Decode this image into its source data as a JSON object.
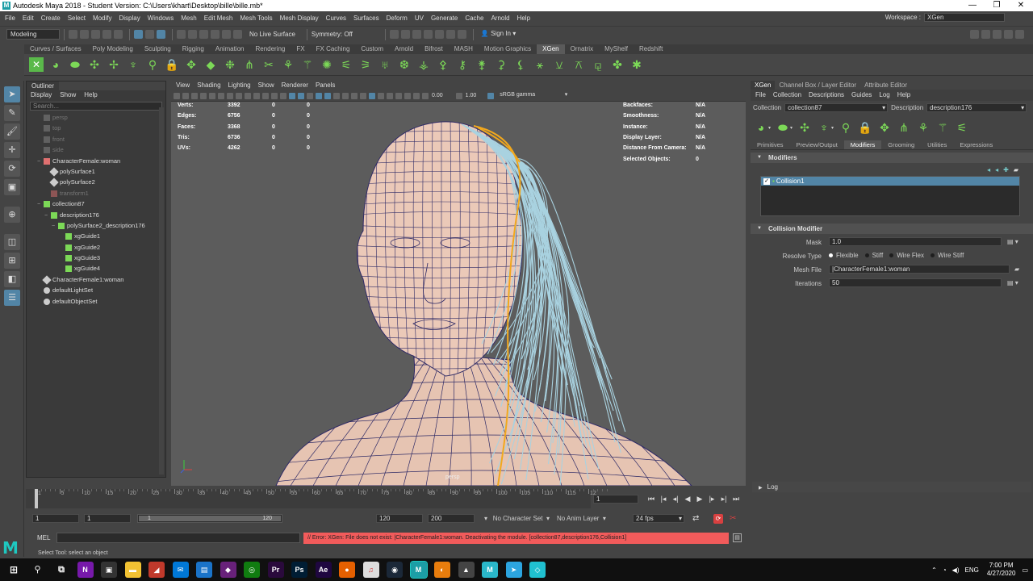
{
  "window": {
    "title": "Autodesk Maya 2018 - Student Version: C:\\Users\\khart\\Desktop\\bille\\bille.mb*",
    "controls": [
      "—",
      "❐",
      "✕"
    ]
  },
  "menubar": {
    "items": [
      "File",
      "Edit",
      "Create",
      "Select",
      "Modify",
      "Display",
      "Windows",
      "Mesh",
      "Edit Mesh",
      "Mesh Tools",
      "Mesh Display",
      "Curves",
      "Surfaces",
      "Deform",
      "UV",
      "Generate",
      "Cache",
      "Arnold",
      "Help"
    ],
    "workspace_label": "Workspace :",
    "workspace_value": "XGen"
  },
  "statusline": {
    "mode": "Modeling",
    "live_surface": "No Live Surface",
    "symmetry": "Symmetry: Off",
    "sign_in": "Sign In"
  },
  "shelf": {
    "tabs": [
      "Curves / Surfaces",
      "Poly Modeling",
      "Sculpting",
      "Rigging",
      "Animation",
      "Rendering",
      "FX",
      "FX Caching",
      "Custom",
      "Arnold",
      "Bifrost",
      "MASH",
      "Motion Graphics",
      "XGen",
      "Ornatrix",
      "MyShelf",
      "Redshift"
    ],
    "active_tab": "XGen"
  },
  "outliner": {
    "tab": "Outliner",
    "menus": [
      "Display",
      "Show",
      "Help"
    ],
    "search_placeholder": "Search...",
    "rows": [
      {
        "label": "persp",
        "indent": 1,
        "dim": true,
        "icon": "camera-icon"
      },
      {
        "label": "top",
        "indent": 1,
        "dim": true,
        "icon": "camera-icon"
      },
      {
        "label": "front",
        "indent": 1,
        "dim": true,
        "icon": "camera-icon"
      },
      {
        "label": "side",
        "indent": 1,
        "dim": true,
        "icon": "camera-icon"
      },
      {
        "label": "CharacterFemale:woman",
        "indent": 1,
        "dim": false,
        "icon": "group-icon",
        "toggle": "−"
      },
      {
        "label": "polySurface1",
        "indent": 2,
        "dim": false,
        "icon": "mesh-icon"
      },
      {
        "label": "polySurface2",
        "indent": 2,
        "dim": false,
        "icon": "mesh-icon"
      },
      {
        "label": "transform1",
        "indent": 2,
        "dim": true,
        "icon": "transform-icon"
      },
      {
        "label": "collection87",
        "indent": 1,
        "dim": false,
        "icon": "xgen-collection-icon",
        "toggle": "−"
      },
      {
        "label": "description176",
        "indent": 2,
        "dim": false,
        "icon": "xgen-description-icon",
        "toggle": "−"
      },
      {
        "label": "polySurface2_description176",
        "indent": 3,
        "dim": false,
        "icon": "xgen-patch-icon",
        "toggle": "−"
      },
      {
        "label": "xgGuide1",
        "indent": 4,
        "dim": false,
        "icon": "xgen-guide-icon"
      },
      {
        "label": "xgGuide2",
        "indent": 4,
        "dim": false,
        "icon": "xgen-guide-icon"
      },
      {
        "label": "xgGuide3",
        "indent": 4,
        "dim": false,
        "icon": "xgen-guide-icon"
      },
      {
        "label": "xgGuide4",
        "indent": 4,
        "dim": false,
        "icon": "xgen-guide-icon"
      },
      {
        "label": "CharacterFemale1:woman",
        "indent": 1,
        "dim": false,
        "icon": "mesh-icon"
      },
      {
        "label": "defaultLightSet",
        "indent": 1,
        "dim": false,
        "icon": "set-icon"
      },
      {
        "label": "defaultObjectSet",
        "indent": 1,
        "dim": false,
        "icon": "set-icon"
      }
    ]
  },
  "viewport": {
    "menus": [
      "View",
      "Shading",
      "Lighting",
      "Show",
      "Renderer",
      "Panels"
    ],
    "toolbar_value_1": "0.00",
    "toolbar_value_2": "1.00",
    "color_space": "sRGB gamma",
    "hud_left": [
      {
        "label": "Verts:",
        "v1": "3392",
        "v2": "0",
        "v3": "0"
      },
      {
        "label": "Edges:",
        "v1": "6756",
        "v2": "0",
        "v3": "0"
      },
      {
        "label": "Faces:",
        "v1": "3368",
        "v2": "0",
        "v3": "0"
      },
      {
        "label": "Tris:",
        "v1": "6736",
        "v2": "0",
        "v3": "0"
      },
      {
        "label": "UVs:",
        "v1": "4262",
        "v2": "0",
        "v3": "0"
      }
    ],
    "hud_right": [
      {
        "label": "Backfaces:",
        "value": "N/A"
      },
      {
        "label": "Smoothness:",
        "value": "N/A"
      },
      {
        "label": "Instance:",
        "value": "N/A"
      },
      {
        "label": "Display Layer:",
        "value": "N/A"
      },
      {
        "label": "Distance From Camera:",
        "value": "N/A"
      },
      {
        "label": "Selected Objects:",
        "value": "0"
      }
    ],
    "camera_label": "persp",
    "colors": {
      "skin": "#e6c4b2",
      "wire": "#2e2a66",
      "hair": "#a9d2e0",
      "guide": "#f2a81d",
      "background": "#5c5c5c"
    }
  },
  "xgen": {
    "tabs": [
      "XGen",
      "Channel Box / Layer Editor",
      "Attribute Editor"
    ],
    "active_tab": "XGen",
    "menus": [
      "File",
      "Collection",
      "Descriptions",
      "Guides",
      "Log",
      "Help"
    ],
    "collection_label": "Collection",
    "collection_value": "collection87",
    "description_label": "Description",
    "description_value": "description176",
    "subtabs": [
      "Primitives",
      "Preview/Output",
      "Modifiers",
      "Grooming",
      "Utilities",
      "Expressions"
    ],
    "active_subtab": "Modifiers",
    "modifiers_section": "Modifiers",
    "modifier_item": "Collision1",
    "collision_section": "Collision Modifier",
    "mask_label": "Mask",
    "mask_value": "1.0",
    "resolve_label": "Resolve Type",
    "resolve_options": [
      "Flexible",
      "Stiff",
      "Wire Flex",
      "Wire Stiff"
    ],
    "resolve_selected": "Flexible",
    "meshfile_label": "Mesh File",
    "meshfile_value": "|CharacterFemale1:woman",
    "iterations_label": "Iterations",
    "iterations_value": "50",
    "log_section": "Log"
  },
  "timeslider": {
    "ticks": [
      "1",
      "5",
      "10",
      "15",
      "20",
      "25",
      "30",
      "35",
      "40",
      "45",
      "50",
      "55",
      "60",
      "65",
      "70",
      "75",
      "80",
      "85",
      "90",
      "95",
      "100",
      "105",
      "110",
      "115",
      "12"
    ],
    "current_frame": "1"
  },
  "range": {
    "start": "1",
    "playback_start": "1",
    "slider_start": "1",
    "slider_end": "120",
    "playback_end": "120",
    "end": "200",
    "character_set": "No Character Set",
    "anim_layer": "No Anim Layer",
    "fps": "24 fps"
  },
  "command": {
    "language": "MEL",
    "error": "// Error: XGen:  File does not exist: |CharacterFemale1:woman. Deactivating the module. [collection87,description176,Collision1]",
    "help": "Select Tool: select an object"
  },
  "taskbar": {
    "language": "ENG",
    "time": "7:00 PM",
    "date": "4/27/2020",
    "apps": [
      {
        "name": "onenote-icon",
        "color": "#7719aa",
        "glyph": "N"
      },
      {
        "name": "store-icon",
        "color": "#333",
        "glyph": "▣"
      },
      {
        "name": "explorer-icon",
        "color": "#f2c233",
        "glyph": "▬"
      },
      {
        "name": "app-red-icon",
        "color": "#c0392b",
        "glyph": "◢"
      },
      {
        "name": "mail-icon",
        "color": "#0078d7",
        "glyph": "✉"
      },
      {
        "name": "app-blue-icon",
        "color": "#1a73c8",
        "glyph": "▤"
      },
      {
        "name": "visual-studio-icon",
        "color": "#68217a",
        "glyph": "◆"
      },
      {
        "name": "xbox-icon",
        "color": "#107c10",
        "glyph": "◎"
      },
      {
        "name": "premiere-icon",
        "color": "#2a0a3c",
        "glyph": "Pr"
      },
      {
        "name": "photoshop-icon",
        "color": "#001d34",
        "glyph": "Ps"
      },
      {
        "name": "after-effects-icon",
        "color": "#1f0740",
        "glyph": "Ae"
      },
      {
        "name": "firefox-icon",
        "color": "#e66000",
        "glyph": "●"
      },
      {
        "name": "itunes-icon",
        "color": "#ddd",
        "glyph": "♫"
      },
      {
        "name": "steam-icon",
        "color": "#1b2838",
        "glyph": "◉"
      },
      {
        "name": "maya-icon",
        "color": "#1c9ea6",
        "glyph": "M"
      },
      {
        "name": "blender-icon",
        "color": "#e87d0d",
        "glyph": "◐"
      },
      {
        "name": "app-image-icon",
        "color": "#444",
        "glyph": "▲"
      },
      {
        "name": "maya-alt-icon",
        "color": "#2ab7c9",
        "glyph": "M"
      },
      {
        "name": "telegram-icon",
        "color": "#2ca5e0",
        "glyph": "➤"
      },
      {
        "name": "app-cyan-icon",
        "color": "#20c0d0",
        "glyph": "◇"
      }
    ]
  }
}
